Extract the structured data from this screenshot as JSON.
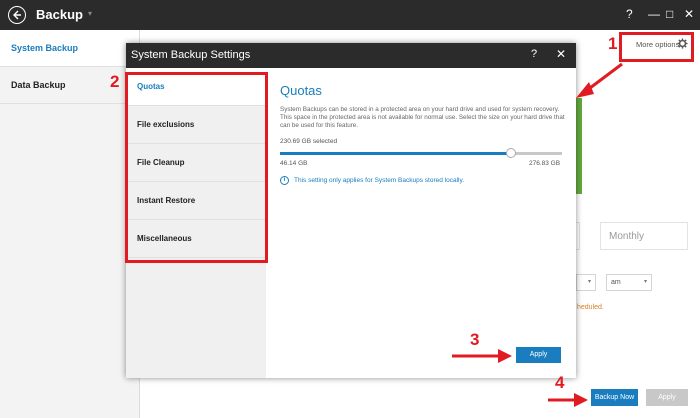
{
  "app": {
    "title": "Backup"
  },
  "window_controls": {
    "help": "?",
    "minimize": "—",
    "maximize": "□",
    "close": "✕"
  },
  "sidebar": {
    "items": [
      {
        "label": "System Backup"
      },
      {
        "label": "Data Backup"
      }
    ]
  },
  "main": {
    "more_options": "More options",
    "monthly": "Monthly",
    "time_select_1": "",
    "time_select_2": "am",
    "scheduled_text": "heduled.",
    "backup_now": "Backup Now",
    "apply": "Apply"
  },
  "dialog": {
    "title": "System Backup Settings",
    "help": "?",
    "close": "✕",
    "nav": [
      {
        "label": "Quotas"
      },
      {
        "label": "File exclusions"
      },
      {
        "label": "File Cleanup"
      },
      {
        "label": "Instant Restore"
      },
      {
        "label": "Miscellaneous"
      }
    ],
    "quotas": {
      "heading": "Quotas",
      "description": "System Backups can be stored in a protected area on your hard drive and used for system recovery. This space in the protected area is not available for normal use. Select the size on your hard drive that can be used for this feature.",
      "selected": "230.69 GB selected",
      "min": "46.14 GB",
      "max": "276.83 GB",
      "slider_fraction": 0.82,
      "info": "This setting only applies for System Backups stored locally."
    },
    "apply": "Apply"
  },
  "annotations": [
    {
      "label": "1"
    },
    {
      "label": "2"
    },
    {
      "label": "3"
    },
    {
      "label": "4"
    }
  ],
  "colors": {
    "accent": "#1a7dbf",
    "annotation": "#e11b22",
    "titlebar": "#2b2b2b"
  }
}
